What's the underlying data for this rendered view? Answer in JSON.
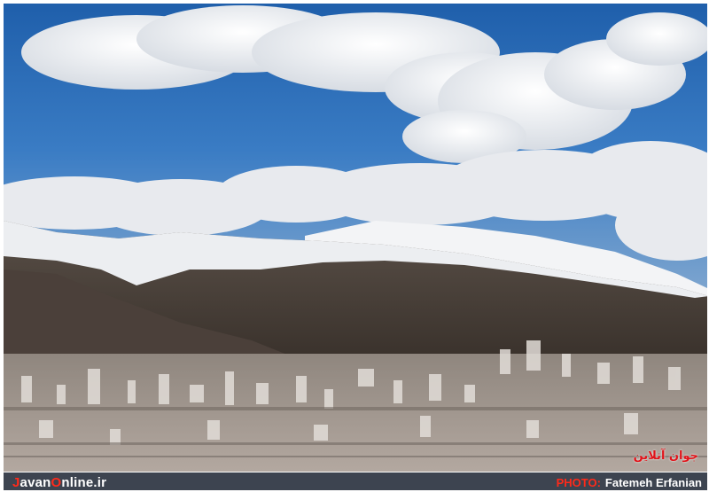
{
  "photo": {
    "subject": "snow-capped-mountains-over-city",
    "colors": {
      "sky": "#2f6fb8",
      "snow": "#f1f2f4",
      "mountain": "#4a4038",
      "city": "#9a8f86"
    }
  },
  "watermark": {
    "text": "جوان آنلاین"
  },
  "caption_bar": {
    "logo": {
      "initial": "J",
      "mid": "avan",
      "o": "O",
      "rest": "nline.ir"
    },
    "credit_label": "PHOTO:",
    "credit_name": "Fatemeh Erfanian",
    "colors": {
      "bar": "#3d4450",
      "accent": "#ff2a1a"
    }
  }
}
